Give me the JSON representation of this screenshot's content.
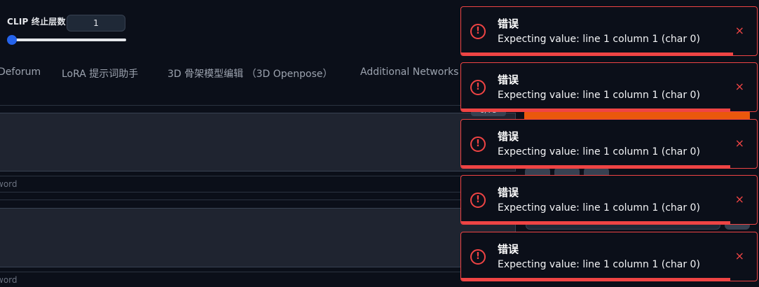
{
  "settings": {
    "clip_label": "CLIP 终止层数",
    "clip_value": "1",
    "clip_slider_fraction": 0.0
  },
  "tabs": [
    {
      "label": "Deforum"
    },
    {
      "label": "LoRA 提示词助手"
    },
    {
      "label": "3D 骨架模型编辑 （3D Openpose）"
    },
    {
      "label": "Additional Networks"
    }
  ],
  "prompt": {
    "token_counter": "0/75",
    "positive_keyword_placeholder": "word",
    "negative_keyword_placeholder": "word"
  },
  "toasts": [
    {
      "title": "错误",
      "message": "Expecting value: line 1 column 1 (char 0)",
      "close": "×",
      "progress": 0.92
    },
    {
      "title": "错误",
      "message": "Expecting value: line 1 column 1 (char 0)",
      "close": "×",
      "progress": 0.91
    },
    {
      "title": "错误",
      "message": "Expecting value: line 1 column 1 (char 0)",
      "close": "×",
      "progress": 0.91
    },
    {
      "title": "错误",
      "message": "Expecting value: line 1 column 1 (char 0)",
      "close": "×",
      "progress": 0.91
    },
    {
      "title": "错误",
      "message": "Expecting value: line 1 column 1 (char 0)",
      "close": "×",
      "progress": 0.91
    }
  ],
  "colors": {
    "background": "#0b0f19",
    "error": "#ef4444",
    "accent": "#2563eb",
    "generate": "#ea580c"
  }
}
